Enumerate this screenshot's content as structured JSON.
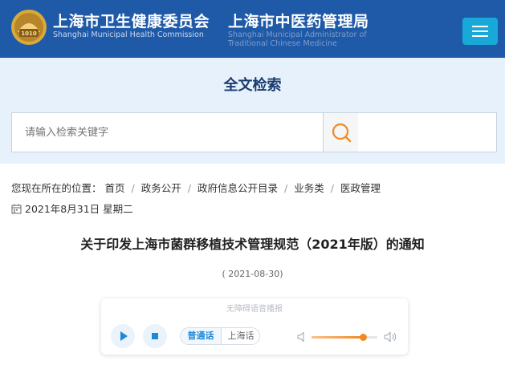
{
  "header": {
    "title_cn_1": "上海市卫生健康委员会",
    "title_en_1": "Shanghai Municipal Health Commission",
    "title_cn_2": "上海市中医药管理局",
    "title_en_2a": "Shanghai Municipal Administrator of",
    "title_en_2b": "Traditional Chinese Medicine",
    "bg_color": "#1f5aa8",
    "menu_color": "#18a9d9"
  },
  "search": {
    "title": "全文检索",
    "placeholder": "请输入检索关键字",
    "icon": "search-icon",
    "accent": "#f08a25"
  },
  "breadcrumb": {
    "prefix": "您现在所在的位置：",
    "items": [
      "首页",
      "政务公开",
      "政府信息公开目录",
      "业务类",
      "医政管理"
    ],
    "separator": "/"
  },
  "date_line": {
    "icon": "calendar-icon",
    "text": "2021年8月31日 星期二"
  },
  "article": {
    "title": "关于印发上海市菌群移植技术管理规范（2021年版）的通知",
    "date": "( 2021-08-30)"
  },
  "player": {
    "label": "无障碍语音播报",
    "lang_options": [
      "普通话",
      "上海话"
    ],
    "selected_lang": "普通话",
    "volume": 0.78,
    "accent": "#f08a25"
  }
}
